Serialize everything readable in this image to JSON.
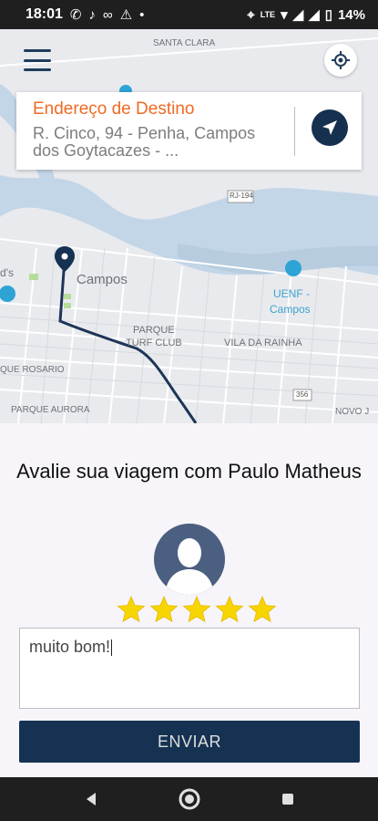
{
  "status_bar": {
    "time": "18:01",
    "battery": "14%"
  },
  "map": {
    "labels": [
      "SANTA CLARA",
      "RJ-194",
      "Campos",
      "UENF -",
      "Campos",
      "PARQUE",
      "TURF CLUB",
      "VILA DA RAINHA",
      "QUE ROSARIO",
      "PARQUE AURORA",
      "NOVO J",
      "356",
      "d's"
    ]
  },
  "destination": {
    "title": "Endereço de Destino",
    "address": "R. Cinco, 94 - Penha, Campos dos Goytacazes - ..."
  },
  "rating": {
    "title": "Avalie sua viagem com Paulo Matheus",
    "stars": 5,
    "stars_max": 5,
    "comment": "muito bom!",
    "submit_label": "ENVIAR"
  },
  "colors": {
    "accent": "#f06a24",
    "primary": "#163252",
    "star": "#f7d500"
  }
}
